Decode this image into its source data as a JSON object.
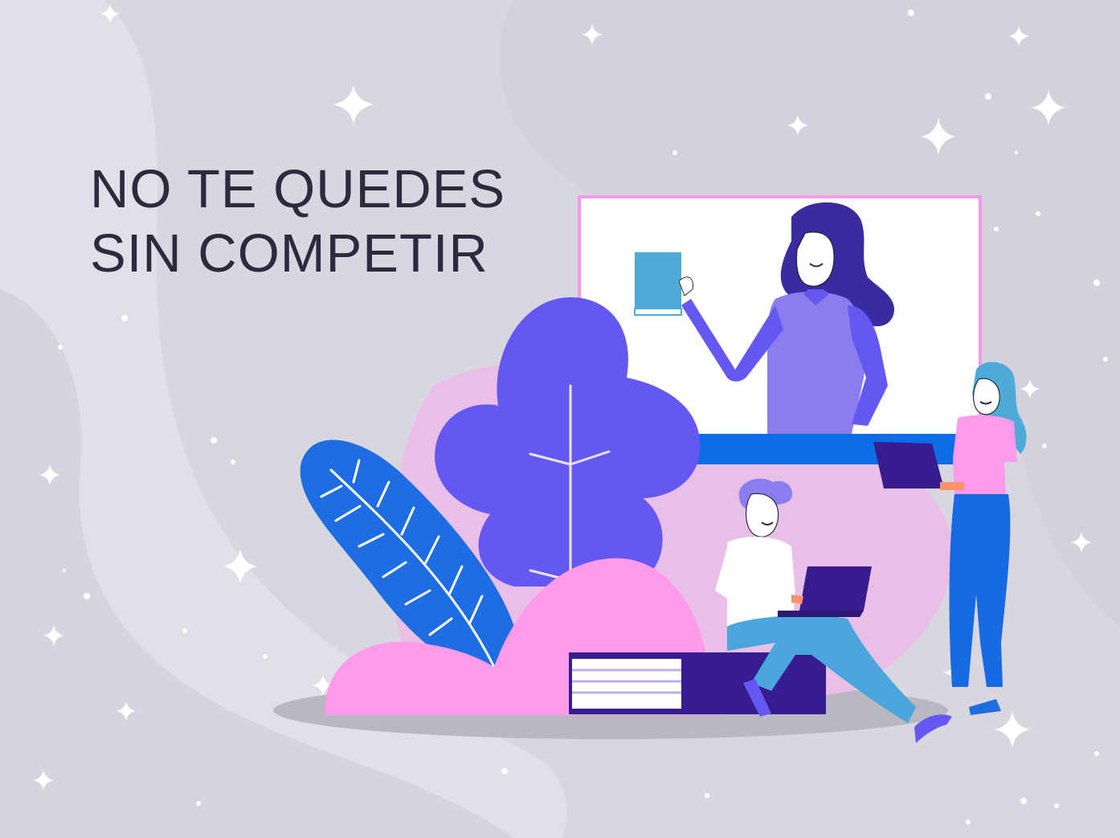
{
  "headline": {
    "line1": "NO TE QUEDES",
    "line2": "SIN COMPETIR"
  },
  "colors": {
    "background": "#d8d7e0",
    "background_light": "#e1e0e9",
    "background_shadow": "#cecdd6",
    "text": "#2c2a3f",
    "screen_border": "#f599e8",
    "screen_bar": "#0b6ee6",
    "purple_leaf": "#6557f1",
    "blue_leaf": "#1e6de2",
    "pink_bush": "#fd9bea",
    "lavender_blob": "#e9bfe8",
    "dark_purple": "#361c8f",
    "teal_book": "#4eaad8",
    "sweater": "#8b7cf0",
    "hair": "#3b2ba1",
    "jeans": "#1769e4",
    "pants": "#4aa6dc",
    "sparkle": "#ffffff"
  },
  "illustration": {
    "icons": [
      "sparkle-icon",
      "plant-leaf",
      "presenter-woman",
      "student-man-laptop",
      "standing-woman-laptop",
      "book-stack"
    ]
  }
}
